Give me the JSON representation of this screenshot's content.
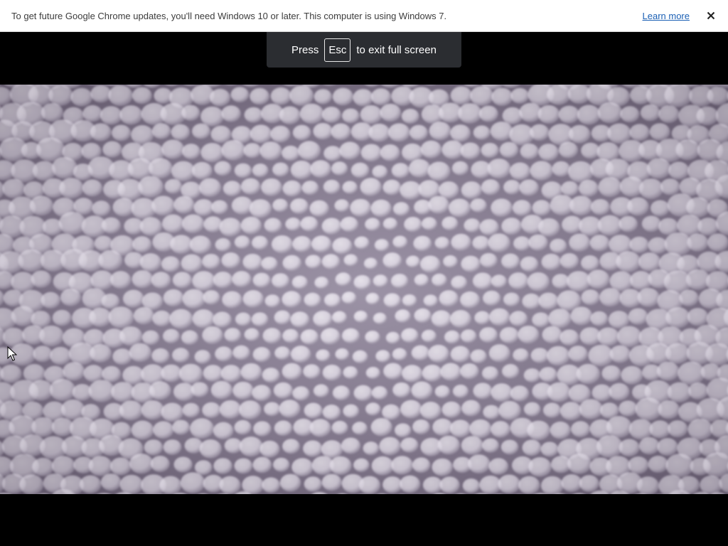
{
  "infobar": {
    "message": "To get future Google Chrome updates, you'll need Windows 10 or later. This computer is using Windows 7.",
    "learn_more": "Learn more",
    "close_icon": "close-icon"
  },
  "fullscreen_toast": {
    "prefix": "Press",
    "key": "Esc",
    "suffix": "to exit full screen"
  },
  "video": {
    "content": "blurred macro image of many small round white beads on a mauve background"
  },
  "colors": {
    "infobar_bg": "#ffffff",
    "link": "#1a5fb4",
    "toast_bg": "#2b2d31",
    "stage_bg": "#000000",
    "bead_tint": "#e7e2ec"
  }
}
